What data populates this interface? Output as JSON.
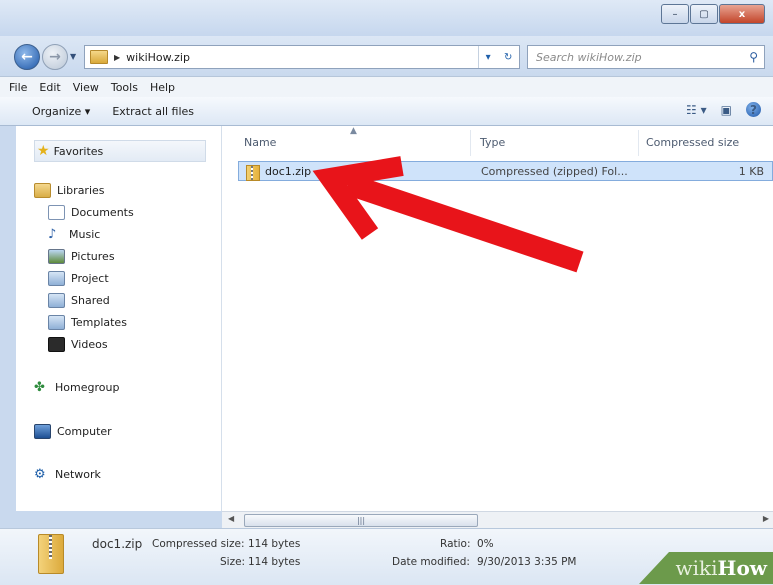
{
  "window": {
    "minimize": "–",
    "maximize": "▢",
    "close": "x"
  },
  "address": {
    "path": "wikiHow.zip",
    "search_placeholder": "Search wikiHow.zip"
  },
  "menu": [
    "File",
    "Edit",
    "View",
    "Tools",
    "Help"
  ],
  "toolbar": {
    "organize": "Organize ▾",
    "extract": "Extract all files"
  },
  "nav": {
    "favorites": "Favorites",
    "libraries": "Libraries",
    "library_items": [
      "Documents",
      "Music",
      "Pictures",
      "Project",
      "Shared",
      "Templates",
      "Videos"
    ],
    "homegroup": "Homegroup",
    "computer": "Computer",
    "network": "Network"
  },
  "columns": {
    "name": "Name",
    "type": "Type",
    "size": "Compressed size"
  },
  "file_row": {
    "name": "doc1.zip",
    "type": "Compressed (zipped) Fol...",
    "size": "1 KB"
  },
  "details": {
    "filename": "doc1.zip",
    "compressed_label": "Compressed size:",
    "compressed_value": "114 bytes",
    "size_label": "Size:",
    "size_value": "114 bytes",
    "ratio_label": "Ratio:",
    "ratio_value": "0%",
    "modified_label": "Date modified:",
    "modified_value": "9/30/2013 3:35 PM"
  },
  "watermark": {
    "part1": "wiki",
    "part2": "How"
  },
  "colors": {
    "arrow": "#e8141a",
    "selection": "#cfe3fa"
  }
}
